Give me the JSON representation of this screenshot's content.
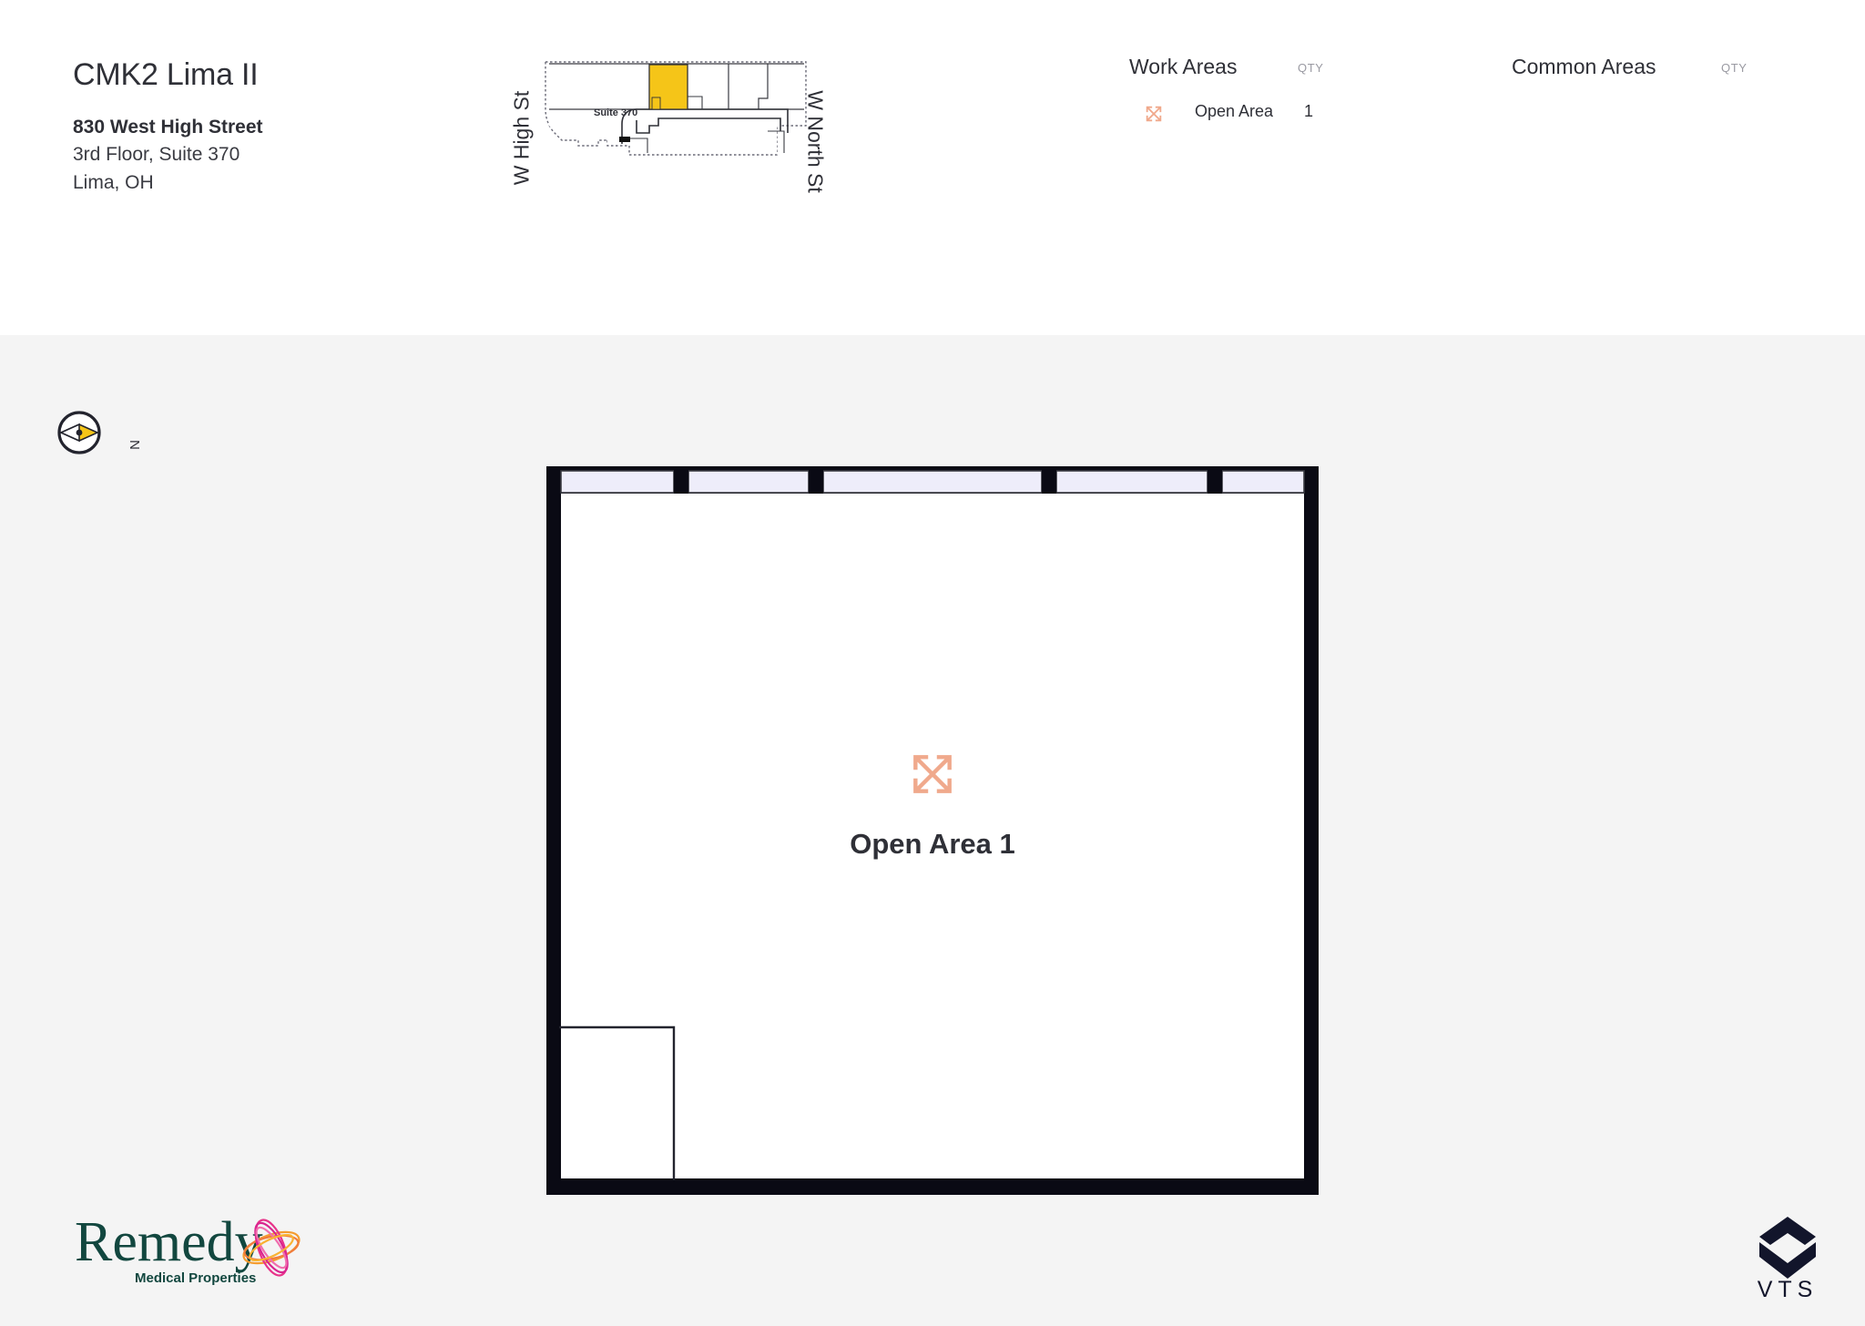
{
  "header": {
    "building_name": "CMK2 Lima II",
    "address_street": "830 West High Street",
    "address_floor_suite": "3rd Floor, Suite 370",
    "address_city_state": "Lima, OH"
  },
  "key_plan": {
    "street_left_label": "W High St",
    "street_right_label": "W North St",
    "highlighted_suite_label": "Suite 370",
    "highlight_color": "#F5C518"
  },
  "legend": {
    "work_areas": {
      "title": "Work Areas",
      "qty_header": "QTY",
      "items": [
        {
          "icon": "expand-arrows-icon",
          "label": "Open Area",
          "qty": "1"
        }
      ]
    },
    "common_areas": {
      "title": "Common Areas",
      "qty_header": "QTY",
      "items": []
    }
  },
  "compass": {
    "north_label": "N",
    "needle_color": "#F5C518"
  },
  "floor_plan": {
    "rooms": [
      {
        "name": "Open Area 1",
        "icon": "expand-arrows-icon",
        "icon_color": "#F0A98C"
      }
    ],
    "window_color": "#EEEDFA",
    "wall_color": "#0A0A14"
  },
  "footer": {
    "brand_logo": {
      "name": "Remedy",
      "tagline": "Medical Properties",
      "color": "#12473F"
    },
    "platform_logo": {
      "name": "VTS",
      "color": "#12152B"
    }
  }
}
